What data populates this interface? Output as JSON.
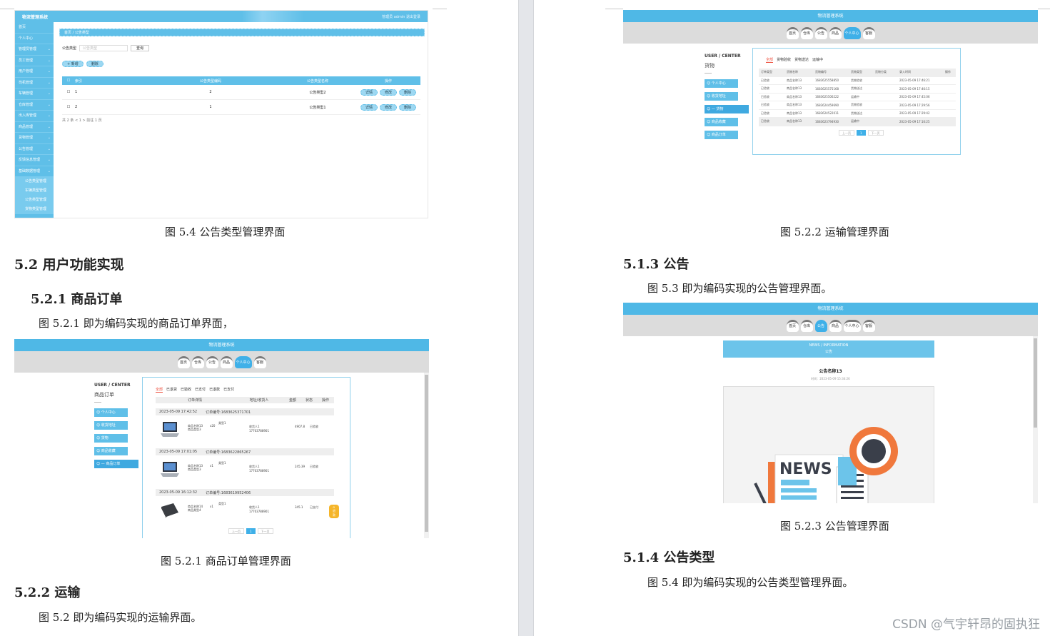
{
  "left_page": {
    "fig54_caption": "图 5.4  公告类型管理界面",
    "sec52": "5.2  用户功能实现",
    "sec521": "5.2.1  商品订单",
    "para521": "图 5.2.1  即为编码实现的商品订单界面，",
    "fig521_caption": "图 5.2.1  商品订单管理界面",
    "sec522": "5.2.2  运输",
    "para522": "图 5.2  即为编码实现的运输界面。"
  },
  "right_page": {
    "fig522_caption": "图 5.2.2  运输管理界面",
    "sec513": "5.1.3  公告",
    "para513": "图 5.3  即为编码实现的公告管理界面。",
    "fig523_caption": "图 5.2.3  公告管理界面",
    "sec514": "5.1.4  公告类型",
    "para514": "图 5.4  即为编码实现的公告类型管理界面。"
  },
  "watermark": "CSDN @气宇轩昂的固执狂",
  "admin_shot": {
    "app_title": "物流管理系统",
    "top_right": "管理员 admin    退出登录",
    "sidebar": [
      "首页",
      "个人中心",
      "管理员管理",
      "员工管理",
      "用户管理",
      "司机管理",
      "车辆管理",
      "仓库管理",
      "出入库管理",
      "商品管理",
      "货物管理",
      "公告管理",
      "反馈信息管理",
      "基础数据管理"
    ],
    "sidebar_sub": [
      "公告类型管理",
      "车辆类型管理",
      "公告类型管理",
      "货物类型管理"
    ],
    "breadcrumb": "首页 / 公告类型",
    "search_label": "公告类型",
    "search_placeholder": "公告类型",
    "search_btn": "查询",
    "add_btn": "+ 新增",
    "delete_btn": "删除",
    "columns": [
      "索引",
      "公告类型编码",
      "公告类型名称",
      "操作"
    ],
    "rows": [
      {
        "idx": "1",
        "code": "2",
        "name": "公告类型2"
      },
      {
        "idx": "2",
        "code": "1",
        "name": "公告类型1"
      }
    ],
    "row_actions": [
      "详情",
      "修改",
      "删除"
    ],
    "pagination": "共 2 条   <   1   >   前往   1   页"
  },
  "transport_shot": {
    "app_title": "物流管理系统",
    "nav": [
      "首页",
      "仓库",
      "公告",
      "商品",
      "个人中心",
      "客服"
    ],
    "active_nav": "个人中心",
    "side_header": "USER / CENTER",
    "side_sub": "货物",
    "menu": [
      "个人中心",
      "收货地址",
      "货物",
      "商品收藏",
      "商品订单"
    ],
    "active_menu": "货物",
    "tabs": [
      "全部",
      "货物验收",
      "货物送达",
      "运输中"
    ],
    "columns": [
      "订单类型",
      "货物名称",
      "货物编号",
      "货物类型",
      "货物分类",
      "录入时间",
      "操作"
    ],
    "rows": [
      [
        "已验收",
        "商品名称13",
        "1683625558850",
        "货物验收",
        "",
        "2023-05-09 17:46:21"
      ],
      [
        "已验收",
        "商品名称13",
        "1683625575168",
        "货物送达",
        "",
        "2023-05-09 17:46:15"
      ],
      [
        "已验收",
        "商品名称13",
        "1683625506222",
        "运输中",
        "",
        "2023-05-09 17:45:06"
      ],
      [
        "已验收",
        "商品名称13",
        "1683624459690",
        "货物验收",
        "",
        "2023-05-09 17:29:56"
      ],
      [
        "已验收",
        "商品名称13",
        "1683624522011",
        "货物送达",
        "",
        "2023-05-09 17:29:42"
      ],
      [
        "已验收",
        "商品名称13",
        "1683623794930",
        "运输中",
        "",
        "2023-05-09 17:16:25"
      ]
    ],
    "pager": [
      "上一页",
      "1",
      "下一页"
    ]
  },
  "orders_shot": {
    "app_title": "物流管理系统",
    "nav": [
      "首页",
      "仓库",
      "公告",
      "商品",
      "个人中心",
      "客服"
    ],
    "side_header": "USER / CENTER",
    "side_sub": "商品订单",
    "menu": [
      "个人中心",
      "收货地址",
      "货物",
      "商品收藏",
      "商品订单"
    ],
    "active_menu": "商品订单",
    "tabs": [
      "全部",
      "已退货",
      "已验收",
      "已支付",
      "已退款",
      "已支付"
    ],
    "columns": [
      "订单详情",
      "地址/收货人",
      "金额",
      "状态",
      "操作"
    ],
    "orders": [
      {
        "time": "2023-05-09 17:42:52",
        "no": "订单编号:1683625371701",
        "item": "商品名称13",
        "sub": "商品类型3",
        "qty": "x20",
        "tag": "类型1",
        "recv": "收货人1",
        "phone": "17703788901",
        "amount": "4907.8",
        "status": "已验收",
        "action": ""
      },
      {
        "time": "2023-05-09 17:01:05",
        "no": "订单编号:1683622865267",
        "item": "商品名称13",
        "sub": "商品类型3",
        "qty": "x1",
        "tag": "类型1",
        "recv": "收货人1",
        "phone": "17703788901",
        "amount": "245.39",
        "status": "已验收",
        "action": ""
      },
      {
        "time": "2023-05-09 16:12:32",
        "no": "订单编号:1683619952406",
        "item": "商品名称14",
        "sub": "商品类型4",
        "qty": "x1",
        "tag": "类型1",
        "recv": "收货人1",
        "phone": "17703788901",
        "amount": "345.1",
        "status": "已支付",
        "action": "退款"
      }
    ],
    "pager": [
      "上一页",
      "1",
      "下一页"
    ]
  },
  "notice_shot": {
    "app_title": "物流管理系统",
    "nav": [
      "首页",
      "仓库",
      "公告",
      "商品",
      "个人中心",
      "客服"
    ],
    "banner_en": "NEWS / INFORMATION",
    "banner_cn": "公告",
    "title": "公告名称13",
    "time": "时间：2023-05-09 15:34:26",
    "image_word": "NEWS"
  }
}
